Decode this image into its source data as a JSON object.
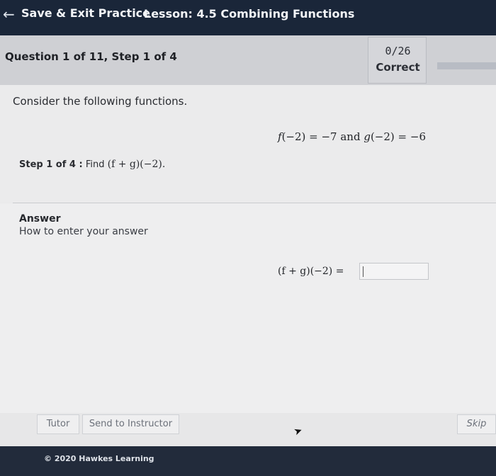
{
  "topbar": {
    "back_icon": "left-arrow-icon",
    "save_exit_label": "Save & Exit Practice",
    "lesson_title": "Lesson: 4.5 Combining Functions"
  },
  "header": {
    "question_label": "Question 1 of 11, Step 1 of 4",
    "score": "0/26",
    "score_label": "Correct",
    "progress_fraction": 0.0
  },
  "question": {
    "intro": "Consider the following functions.",
    "given_f": "f",
    "given_f_rest": "(−2) = −7 and ",
    "given_g": "g",
    "given_g_rest": "(−2) = −6",
    "step_label": "Step 1 of 4 :",
    "find_text": "Find",
    "find_expr": "(f + g)(−2)."
  },
  "answer": {
    "title": "Answer",
    "help_link": "How to enter your answer",
    "equation_label": "(f + g)(−2) =",
    "input_value": ""
  },
  "buttons": {
    "tutor": "Tutor",
    "send_to_instructor": "Send to Instructor",
    "skip": "Skip"
  },
  "footer": {
    "copyright": "© 2020 Hawkes Learning"
  },
  "colors": {
    "topbar_bg": "#1a2639",
    "footer_bg": "#222b3b",
    "header_bg": "#cfd0d4"
  }
}
